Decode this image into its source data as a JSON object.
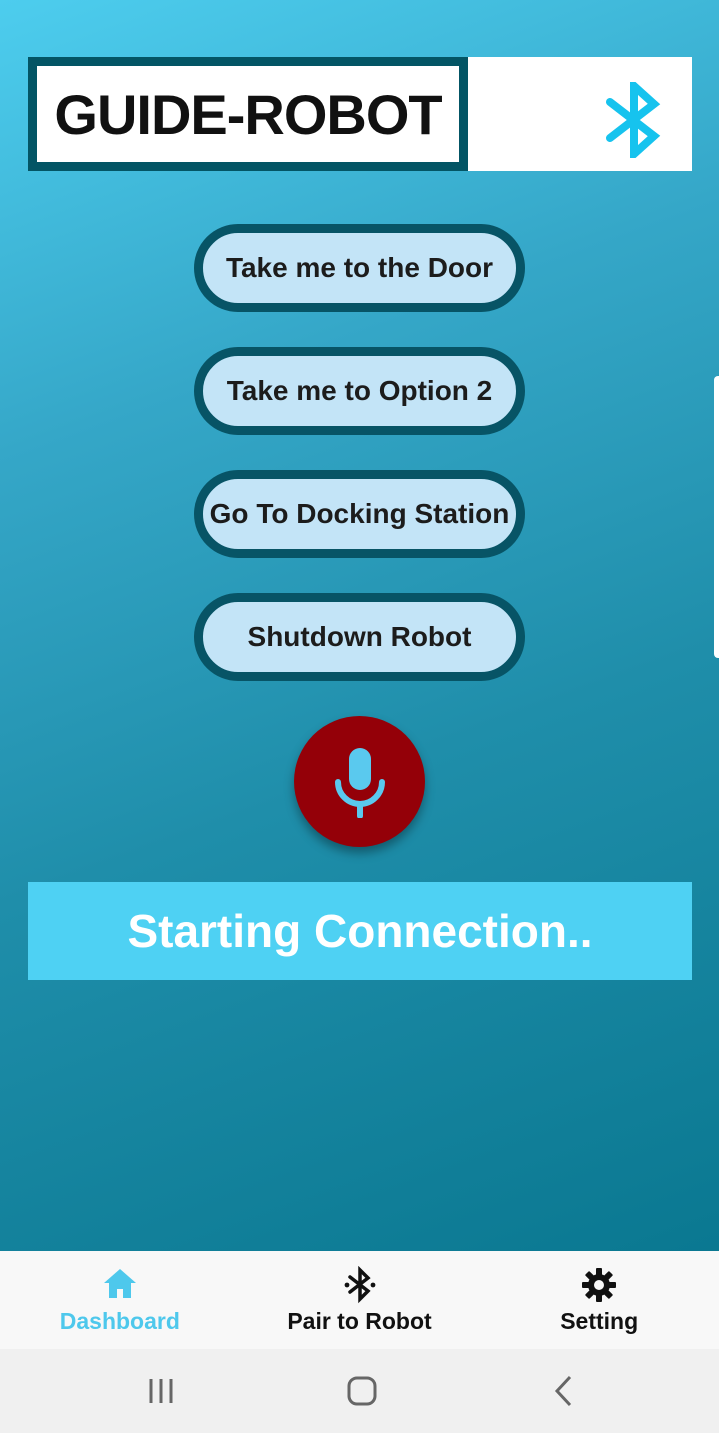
{
  "header": {
    "title": "GUIDE-ROBOT",
    "bluetooth_icon": "bluetooth-icon"
  },
  "actions": [
    {
      "label": "Take me to the Door"
    },
    {
      "label": "Take me to Option 2"
    },
    {
      "label": "Go To Docking Station"
    },
    {
      "label": "Shutdown Robot"
    }
  ],
  "mic": {
    "icon": "microphone-icon"
  },
  "status": {
    "text": "Starting Connection.."
  },
  "bottom_nav": {
    "items": [
      {
        "label": "Dashboard",
        "icon": "home-icon",
        "active": true
      },
      {
        "label": "Pair to Robot",
        "icon": "bluetooth-icon",
        "active": false
      },
      {
        "label": "Setting",
        "icon": "gear-icon",
        "active": false
      }
    ]
  },
  "system_nav": {
    "recents_icon": "recents-icon",
    "home_icon": "home-circle-icon",
    "back_icon": "back-icon"
  },
  "colors": {
    "accent": "#4ed1f3",
    "button_fill": "#c3e4f7",
    "button_border": "#075466",
    "mic": "#940008",
    "active_nav": "#4ec8ec"
  }
}
